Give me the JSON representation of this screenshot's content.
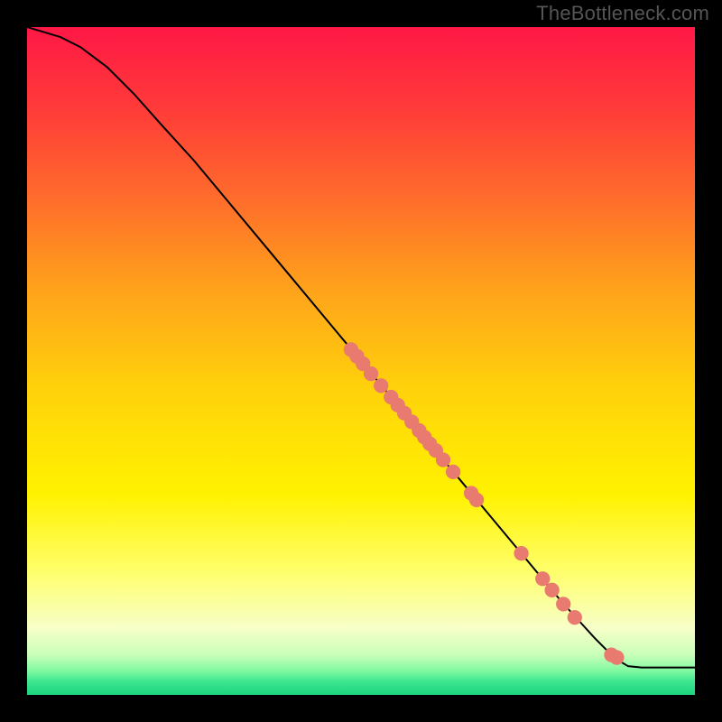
{
  "watermark": "TheBottleneck.com",
  "chart_data": {
    "type": "line",
    "title": "",
    "xlabel": "",
    "ylabel": "",
    "xlim": [
      0,
      100
    ],
    "ylim": [
      0,
      100
    ],
    "curve": [
      {
        "x": 0,
        "y": 100
      },
      {
        "x": 5,
        "y": 98.5
      },
      {
        "x": 8,
        "y": 97
      },
      {
        "x": 12,
        "y": 94
      },
      {
        "x": 16,
        "y": 90
      },
      {
        "x": 20,
        "y": 85.5
      },
      {
        "x": 25,
        "y": 80
      },
      {
        "x": 30,
        "y": 74
      },
      {
        "x": 35,
        "y": 68
      },
      {
        "x": 40,
        "y": 62
      },
      {
        "x": 45,
        "y": 56
      },
      {
        "x": 50,
        "y": 50
      },
      {
        "x": 55,
        "y": 44
      },
      {
        "x": 60,
        "y": 38
      },
      {
        "x": 65,
        "y": 32
      },
      {
        "x": 70,
        "y": 26
      },
      {
        "x": 75,
        "y": 20
      },
      {
        "x": 80,
        "y": 14
      },
      {
        "x": 85,
        "y": 8.5
      },
      {
        "x": 88,
        "y": 5.5
      },
      {
        "x": 90,
        "y": 4.3
      },
      {
        "x": 92,
        "y": 4.1
      },
      {
        "x": 100,
        "y": 4.1
      }
    ],
    "markers": [
      {
        "x": 48.5,
        "y": 51.7
      },
      {
        "x": 49.4,
        "y": 50.7
      },
      {
        "x": 50.3,
        "y": 49.6
      },
      {
        "x": 51.5,
        "y": 48.1
      },
      {
        "x": 53.0,
        "y": 46.3
      },
      {
        "x": 54.5,
        "y": 44.6
      },
      {
        "x": 55.5,
        "y": 43.4
      },
      {
        "x": 56.5,
        "y": 42.2
      },
      {
        "x": 57.6,
        "y": 40.9
      },
      {
        "x": 58.7,
        "y": 39.6
      },
      {
        "x": 59.5,
        "y": 38.6
      },
      {
        "x": 60.3,
        "y": 37.6
      },
      {
        "x": 61.2,
        "y": 36.6
      },
      {
        "x": 62.3,
        "y": 35.2
      },
      {
        "x": 63.8,
        "y": 33.4
      },
      {
        "x": 66.5,
        "y": 30.2
      },
      {
        "x": 67.3,
        "y": 29.2
      },
      {
        "x": 74.0,
        "y": 21.2
      },
      {
        "x": 77.2,
        "y": 17.4
      },
      {
        "x": 78.6,
        "y": 15.7
      },
      {
        "x": 80.3,
        "y": 13.6
      },
      {
        "x": 82.0,
        "y": 11.6
      },
      {
        "x": 87.5,
        "y": 6.0
      },
      {
        "x": 88.3,
        "y": 5.6
      }
    ],
    "marker_color": "#e87a6f",
    "line_color": "#000000",
    "gradient_stops": [
      {
        "offset": 0,
        "color": "#ff1846"
      },
      {
        "offset": 0.12,
        "color": "#ff3a39"
      },
      {
        "offset": 0.25,
        "color": "#ff6a2c"
      },
      {
        "offset": 0.4,
        "color": "#ffa51a"
      },
      {
        "offset": 0.55,
        "color": "#ffd40a"
      },
      {
        "offset": 0.7,
        "color": "#fff200"
      },
      {
        "offset": 0.82,
        "color": "#ffff70"
      },
      {
        "offset": 0.9,
        "color": "#f7ffc8"
      },
      {
        "offset": 0.94,
        "color": "#c9ffb8"
      },
      {
        "offset": 0.965,
        "color": "#7cf8a0"
      },
      {
        "offset": 0.98,
        "color": "#3de68f"
      },
      {
        "offset": 1.0,
        "color": "#1cd47e"
      }
    ]
  }
}
